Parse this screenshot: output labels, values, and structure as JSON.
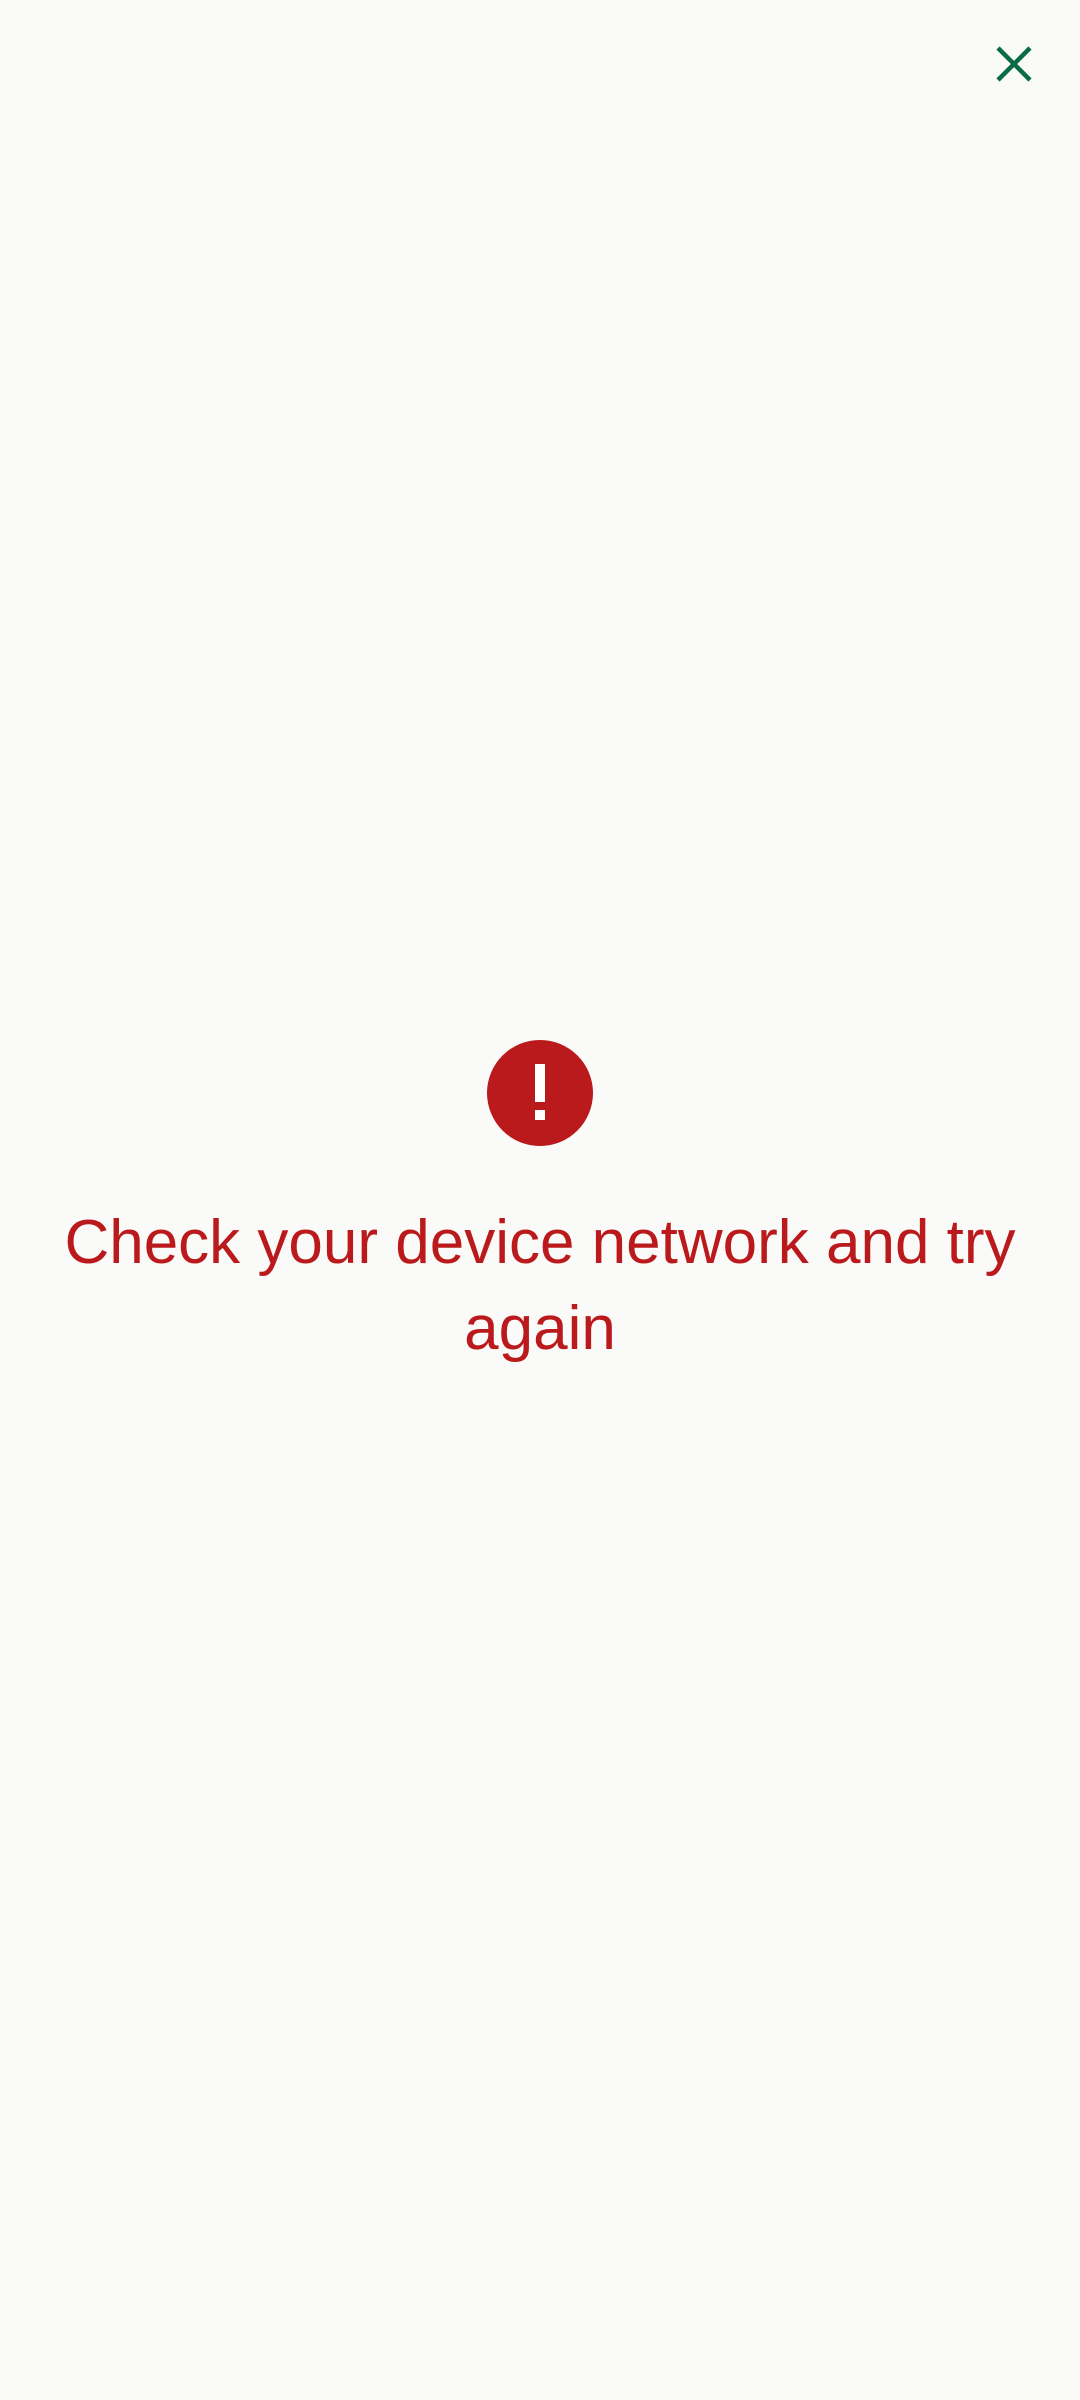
{
  "toolbar": {
    "close_icon": "close-icon",
    "close_color": "#0a6b45"
  },
  "error": {
    "icon": "error-exclamation-icon",
    "color": "#bb1a1d",
    "message": "Check your device network and try again"
  }
}
